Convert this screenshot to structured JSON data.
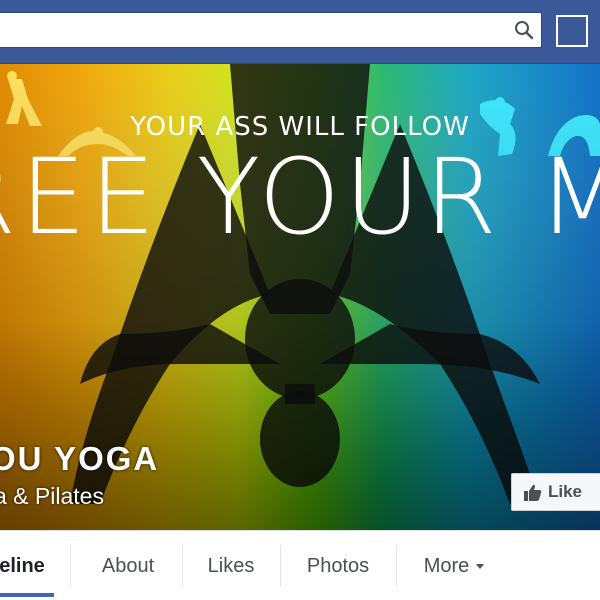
{
  "header": {
    "search_value": "",
    "search_placeholder": ""
  },
  "cover": {
    "tagline": "YOUR ASS WILL FOLLOW",
    "headline": "FREE YOUR MIND",
    "page_name": "OU YOGA",
    "page_category": "a & Pilates",
    "like_label": "Like"
  },
  "tabs": [
    {
      "label": "eline",
      "active": true
    },
    {
      "label": "About"
    },
    {
      "label": "Likes"
    },
    {
      "label": "Photos"
    },
    {
      "label": "More"
    }
  ],
  "colors": {
    "facebook_blue": "#3b5998",
    "active_tab_indicator": "#4267b2"
  }
}
